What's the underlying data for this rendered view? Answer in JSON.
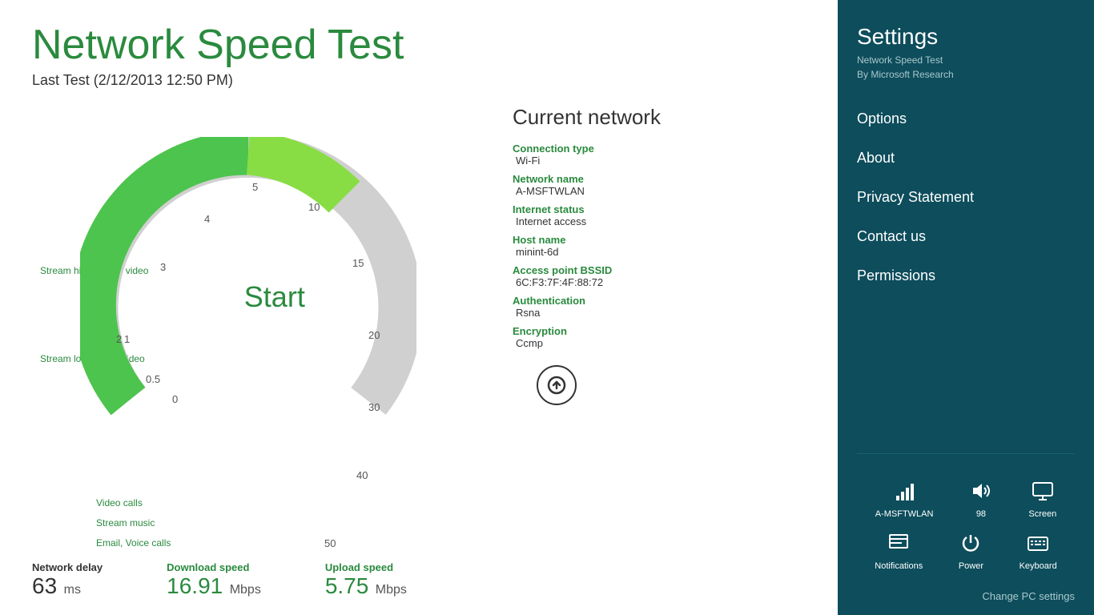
{
  "app": {
    "title": "Network Speed Test",
    "last_test_label": "Last Test (2/12/2013 12:50 PM)"
  },
  "gauge": {
    "start_label": "Start",
    "numbers": [
      "0",
      "0.5",
      "1",
      "2",
      "3",
      "4",
      "5",
      "10",
      "15",
      "20",
      "30",
      "40",
      "50"
    ],
    "activity_labels": [
      {
        "text": "Stream high-quality video",
        "value": 3
      },
      {
        "text": "Stream low-quality video",
        "value": 2
      },
      {
        "text": "Video calls",
        "value": 0.5
      },
      {
        "text": "Stream music",
        "value": 0.5
      },
      {
        "text": "Email, Voice calls",
        "value": 0
      }
    ]
  },
  "network": {
    "section_title": "Current network",
    "fields": [
      {
        "label": "Connection type",
        "value": "Wi-Fi"
      },
      {
        "label": "Network name",
        "value": "A-MSFTWLAN"
      },
      {
        "label": "Internet status",
        "value": "Internet access"
      },
      {
        "label": "Host name",
        "value": "minint-6d"
      },
      {
        "label": "Access point BSSID",
        "value": "6C:F3:7F:4F:88:72"
      },
      {
        "label": "Authentication",
        "value": "Rsna"
      },
      {
        "label": "Encryption",
        "value": "Ccmp"
      }
    ]
  },
  "stats": {
    "network_delay_label": "Network delay",
    "network_delay_value": "63",
    "network_delay_unit": "ms",
    "download_label": "Download speed",
    "download_value": "16.91",
    "download_unit": "Mbps",
    "upload_label": "Upload speed",
    "upload_value": "5.75",
    "upload_unit": "Mbps"
  },
  "sidebar": {
    "title": "Settings",
    "app_name": "Network Speed Test",
    "app_by": "By Microsoft Research",
    "menu_items": [
      {
        "label": "Options",
        "id": "options"
      },
      {
        "label": "About",
        "id": "about"
      },
      {
        "label": "Privacy Statement",
        "id": "privacy"
      },
      {
        "label": "Contact us",
        "id": "contact"
      },
      {
        "label": "Permissions",
        "id": "permissions"
      }
    ],
    "taskbar": {
      "row1": [
        {
          "label": "A-MSFTWLAN",
          "icon": "wifi"
        },
        {
          "label": "98",
          "icon": "volume"
        },
        {
          "label": "Screen",
          "icon": "screen"
        }
      ],
      "row2": [
        {
          "label": "Notifications",
          "icon": "notifications"
        },
        {
          "label": "Power",
          "icon": "power"
        },
        {
          "label": "Keyboard",
          "icon": "keyboard"
        }
      ]
    },
    "change_pc_settings": "Change PC settings"
  }
}
